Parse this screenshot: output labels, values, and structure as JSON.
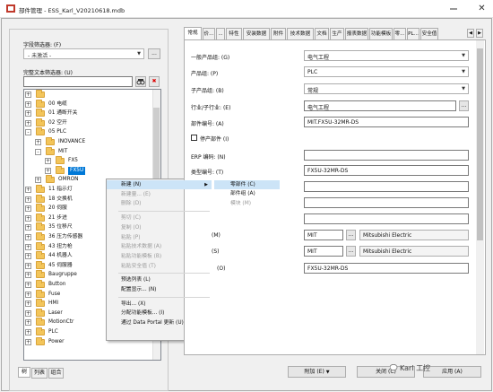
{
  "window": {
    "title": "部件管理 - ESS_Karl_V20210618.mdb"
  },
  "left": {
    "field_filter_label": "字段筛选器: (F)",
    "field_filter_value": "- 未激活 -",
    "field_filter_btn": "...",
    "fulltext_filter_label": "完整文本筛选器: (U)",
    "fulltext_value": "",
    "tree": [
      {
        "label": "",
        "indent": 0,
        "expander": "+"
      },
      {
        "label": "00 电缆",
        "indent": 0,
        "expander": "+"
      },
      {
        "label": "01 通断开关",
        "indent": 0,
        "expander": "+"
      },
      {
        "label": "02 空开",
        "indent": 0,
        "expander": "+"
      },
      {
        "label": "05 PLC",
        "indent": 0,
        "expander": "-"
      },
      {
        "label": "INOVANCE",
        "indent": 1,
        "expander": "+"
      },
      {
        "label": "MIT",
        "indent": 1,
        "expander": "-"
      },
      {
        "label": "FX5",
        "indent": 2,
        "expander": "+"
      },
      {
        "label": "FX5U",
        "indent": 2,
        "expander": "+",
        "selected": true
      },
      {
        "label": "OMRON",
        "indent": 1,
        "expander": "+"
      },
      {
        "label": "11 指示灯",
        "indent": 0,
        "expander": "+"
      },
      {
        "label": "18 交换机",
        "indent": 0,
        "expander": "+"
      },
      {
        "label": "20 伺服",
        "indent": 0,
        "expander": "+"
      },
      {
        "label": "21 步进",
        "indent": 0,
        "expander": "+"
      },
      {
        "label": "35 位移尺",
        "indent": 0,
        "expander": "+"
      },
      {
        "label": "36 压力传感器",
        "indent": 0,
        "expander": "+"
      },
      {
        "label": "43 扭力枪",
        "indent": 0,
        "expander": "+"
      },
      {
        "label": "44 机器人",
        "indent": 0,
        "expander": "+"
      },
      {
        "label": "45 伺服器",
        "indent": 0,
        "expander": "+"
      },
      {
        "label": "Baugruppe",
        "indent": 0,
        "expander": "+"
      },
      {
        "label": "Button",
        "indent": 0,
        "expander": "+"
      },
      {
        "label": "Fuse",
        "indent": 0,
        "expander": "+"
      },
      {
        "label": "HMI",
        "indent": 0,
        "expander": "+"
      },
      {
        "label": "Laser",
        "indent": 0,
        "expander": "+"
      },
      {
        "label": "MotionCtr",
        "indent": 0,
        "expander": "+"
      },
      {
        "label": "PLC",
        "indent": 0,
        "expander": "+"
      },
      {
        "label": "Power",
        "indent": 0,
        "expander": "+"
      }
    ],
    "bottom_tabs": [
      "树",
      "列表",
      "组合"
    ]
  },
  "context_menu": {
    "items": [
      {
        "label": "新建 (N)",
        "disabled": false,
        "highlight": true,
        "submenu": true
      },
      {
        "label": "新建量... (E)",
        "disabled": true
      },
      {
        "label": "删除 (D)",
        "disabled": true
      },
      {
        "sep": true
      },
      {
        "label": "剪切 (C)",
        "disabled": true
      },
      {
        "label": "复制 (O)",
        "disabled": true
      },
      {
        "label": "粘贴 (P)",
        "disabled": true
      },
      {
        "label": "粘贴技术数据 (A)",
        "disabled": true
      },
      {
        "label": "粘贴功能模板 (B)",
        "disabled": true
      },
      {
        "label": "粘贴安全值 (T)",
        "disabled": true
      },
      {
        "sep": true
      },
      {
        "label": "预选列表 (L)",
        "disabled": false
      },
      {
        "label": "配置显示... (N)",
        "disabled": false
      },
      {
        "sep": true
      },
      {
        "label": "导出... (X)",
        "disabled": false
      },
      {
        "label": "分配功能模板... (I)",
        "disabled": false
      },
      {
        "label": "通过 Data Portal 更新 (U)",
        "disabled": false
      }
    ],
    "submenu": [
      {
        "label": "零部件 (C)",
        "highlight": true
      },
      {
        "label": "部件组 (A)",
        "disabled": false
      },
      {
        "label": "模块 (M)",
        "disabled": true
      }
    ]
  },
  "right": {
    "tabs": [
      "常规",
      "价...",
      "...",
      "特性",
      "安装数据",
      "附件",
      "技术数据",
      "文档",
      "生产",
      "报表数据",
      "功能模板",
      "零...",
      "PL...",
      "安全值"
    ],
    "fields": {
      "product_group_label": "一般产品组: (G)",
      "product_group_value": "电气工程",
      "product_label": "产品组: (P)",
      "product_value": "PLC",
      "sub_product_label": "子产品组: (B)",
      "sub_product_value": "常规",
      "industry_label": "行业/子行业: (E)",
      "industry_value": "电气工程",
      "part_number_label": "部件编号: (A)",
      "part_number_value": "MIT.FX5U-32MR-DS",
      "discontinued_label": "停产部件 (I)",
      "erp_label": "ERP 编码: (N)",
      "erp_value": "",
      "type_label": "类型编号: (T)",
      "type_value": "FX5U-32MR-DS",
      "manufacturer_label": "(M)",
      "manufacturer_code": "MIT",
      "manufacturer_name": "Mitsubishi Electric",
      "supplier_label": "(S)",
      "supplier_code": "MIT",
      "supplier_name": "Mitsubishi Electric",
      "order_label": "(O)",
      "order_value": "FX5U-32MR-DS",
      "ellipsis": "..."
    },
    "buttons": {
      "add": "附加 (E)",
      "close": "关闭 (C)",
      "apply": "应用 (A)",
      "add_arrow": "▼"
    }
  },
  "watermark": "Karl 工控"
}
